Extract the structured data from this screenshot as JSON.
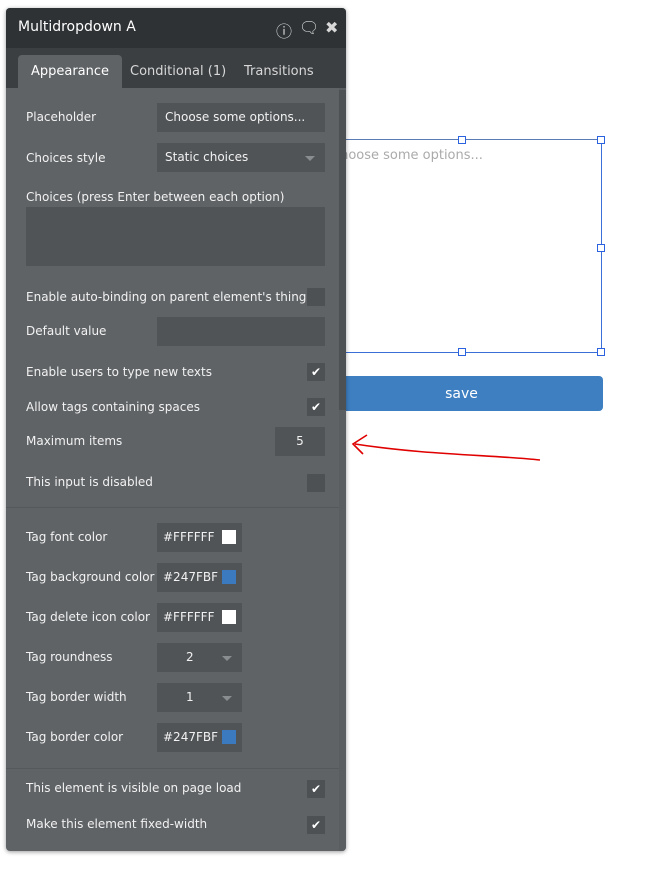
{
  "canvas": {
    "dropdown_placeholder": "Choose some options...",
    "save_label": "save"
  },
  "panel": {
    "title": "Multidropdown A",
    "icons": [
      "info-icon",
      "comment-icon",
      "close-icon"
    ],
    "tabs": [
      {
        "label": "Appearance",
        "active": true
      },
      {
        "label": "Conditional (1)"
      },
      {
        "label": "Transitions"
      }
    ],
    "placeholder_label": "Placeholder",
    "placeholder_value": "Choose some options...",
    "choices_style_label": "Choices style",
    "choices_style_value": "Static choices",
    "choices_label": "Choices (press Enter between each option)",
    "autobind_label": "Enable auto-binding on parent element's thing",
    "default_value_label": "Default value",
    "type_new_label": "Enable users to type new texts",
    "tags_spaces_label": "Allow tags containing spaces",
    "max_items_label": "Maximum items",
    "max_items_value": "5",
    "disabled_label": "This input is disabled",
    "tag_font_color_label": "Tag font color",
    "tag_font_color_value": "#FFFFFF",
    "tag_bg_color_label": "Tag background color",
    "tag_bg_color_value": "#247FBF",
    "tag_delete_color_label": "Tag delete icon color",
    "tag_delete_color_value": "#FFFFFF",
    "tag_roundness_label": "Tag roundness",
    "tag_roundness_value": "2",
    "tag_border_width_label": "Tag border width",
    "tag_border_width_value": "1",
    "tag_border_color_label": "Tag border color",
    "tag_border_color_value": "#247FBF",
    "visible_label": "This element is visible on page load",
    "fixed_width_label": "Make this element fixed-width"
  },
  "colors": {
    "accent": "#3d7fc1",
    "tag_blue": "#3c7ac0",
    "annotation": "#e00000"
  }
}
